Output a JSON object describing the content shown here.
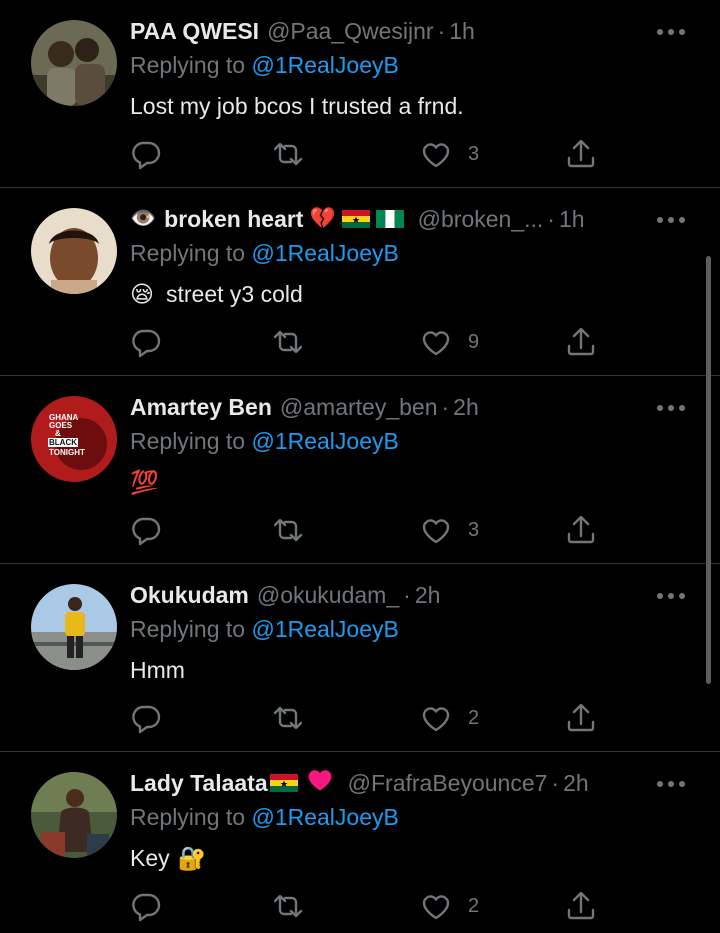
{
  "tweets": [
    {
      "name": "PAA QWESI",
      "emojis": "",
      "handle": "@Paa_Qwesijnr",
      "time": "1h",
      "replying_prefix": "Replying to",
      "replying_to": "@1RealJoeyB",
      "text": "Lost my job bcos I trusted a frnd.",
      "text_emoji": "",
      "likes": "3"
    },
    {
      "name": "broken heart",
      "name_prefix_emoji": "👁️",
      "emojis": "💔🇬🇭🇳🇬",
      "handle": "@broken_...",
      "time": "1h",
      "replying_prefix": "Replying to",
      "replying_to": "@1RealJoeyB",
      "text": "street y3 cold",
      "text_emoji": "😪",
      "likes": "9"
    },
    {
      "name": "Amartey Ben",
      "emojis": "",
      "handle": "@amartey_ben",
      "time": "2h",
      "replying_prefix": "Replying to",
      "replying_to": "@1RealJoeyB",
      "text": "",
      "text_emoji": "💯",
      "likes": "3",
      "avatar_text": [
        "GHANA",
        "GOES",
        "&",
        "BLACK",
        "TONIGHT"
      ]
    },
    {
      "name": "Okukudam",
      "emojis": "",
      "handle": "@okukudam_",
      "time": "2h",
      "replying_prefix": "Replying to",
      "replying_to": "@1RealJoeyB",
      "text": "Hmm",
      "text_emoji": "",
      "likes": "2"
    },
    {
      "name": "Lady Talaata",
      "emojis": "🇬🇭❤️",
      "handle": "@FrafraBeyounce7",
      "time": "2h",
      "replying_prefix": "Replying to",
      "replying_to": "@1RealJoeyB",
      "text": "Key",
      "text_emoji": "🔐",
      "likes": "2"
    }
  ],
  "separator": "·",
  "icons": {
    "reply": "reply-icon",
    "retweet": "retweet-icon",
    "like": "heart-icon",
    "share": "share-icon",
    "more": "more-icon"
  },
  "colors": {
    "background": "#000000",
    "text": "#e7e9ea",
    "secondary": "#71767b",
    "link": "#1d9bf0",
    "divider": "#2f3336"
  }
}
